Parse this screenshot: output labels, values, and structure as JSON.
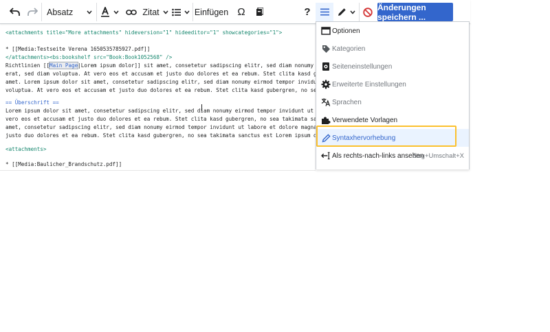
{
  "toolbar": {
    "format_label": "Absatz",
    "cite_label": "Zitat",
    "insert_label": "Einfügen",
    "special_char_glyph": "Ω",
    "help_glyph": "?",
    "save_label": "Änderungen speichern ..."
  },
  "editor": {
    "lines": [
      {
        "text": "<attachments title=\"More attachments\" hideversion=\"1\" hideeditor=\"1\" showcategories=\"1\">"
      },
      {
        "text": ""
      },
      {
        "text": "* [[Media:Testseite Verena 1650535785927.pdf]]"
      },
      {
        "text": "</attachments><bs:bookshelf src=\"Book:Book1052568\" />"
      },
      {
        "pre": "Richtlinien [[",
        "link": "Main Page",
        "post": "|Lorem ipsum dolor]] sit amet, consetetur sadipscing elitr, sed diam nonumy eirmod tempor"
      },
      {
        "text": "erat, sed diam voluptua. At vero eos et accusam et justo duo dolores et ea rebum. Stet clita kasd gubergren, no"
      },
      {
        "text": "amet. Lorem ipsum dolor sit amet, consetetur sadipscing elitr, sed diam nonumy eirmod tempor invidunt ut labore"
      },
      {
        "text": "voluptua. At vero eos et accusam et justo duo dolores et ea rebum. Stet clita kasd gubergren, no sea takimata s"
      },
      {
        "text": ""
      },
      {
        "text": "== Überschrift =="
      },
      {
        "text": "Lorem ipsum dolor sit amet, consetetur sadipscing elitr, sed diam nonumy eirmod tempor invidunt ut labore et do"
      },
      {
        "text": "vero eos et accusam et justo duo dolores et ea rebum. Stet clita kasd gubergren, no sea takimata sanctus est Lo"
      },
      {
        "text": "amet, consetetur sadipscing elitr, sed diam nonumy eirmod tempor invidunt ut labore et dolore magna aliquyam er"
      },
      {
        "text": "justo duo dolores et ea rebum. Stet clita kasd gubergren, no sea takimata sanctus est Lorem ipsum dolor sit ame"
      },
      {
        "text": ""
      },
      {
        "text": "<attachments>"
      },
      {
        "text": ""
      },
      {
        "text": "* [[Media:Baulicher_Brandschutz.pdf]]"
      }
    ]
  },
  "menu": {
    "items": [
      {
        "label": "Optionen",
        "icon": "window-icon",
        "state": "enabled"
      },
      {
        "label": "Kategorien",
        "icon": "tag-icon",
        "state": "disabled"
      },
      {
        "label": "Seiteneinstellungen",
        "icon": "page-settings-icon",
        "state": "disabled"
      },
      {
        "label": "Erweiterte Einstellungen",
        "icon": "gear-icon",
        "state": "disabled"
      },
      {
        "label": "Sprachen",
        "icon": "language-icon",
        "state": "disabled"
      },
      {
        "label": "Verwendete Vorlagen",
        "icon": "puzzle-icon",
        "state": "enabled"
      },
      {
        "label": "Syntaxhervorhebung",
        "icon": "pencil-icon",
        "state": "selected"
      },
      {
        "label": "Als rechts-nach-links ansehen",
        "icon": "rtl-icon",
        "state": "enabled",
        "shortcut": "Strg+Umschalt+X"
      }
    ]
  },
  "colors": {
    "accent": "#3366cc",
    "focus": "#fbc02d",
    "cancel": "#d33333",
    "tag": "#14866d"
  }
}
